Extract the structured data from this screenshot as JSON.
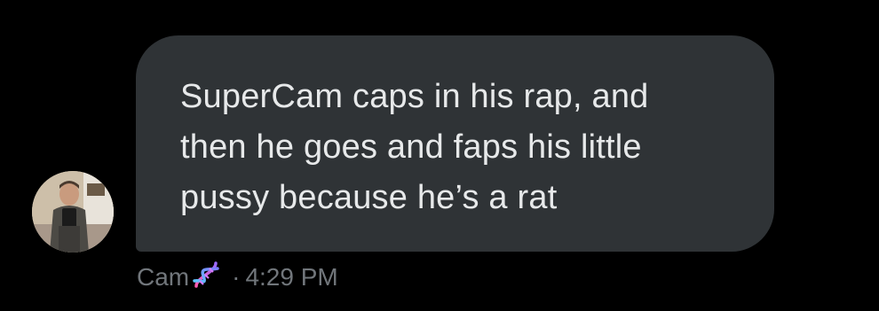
{
  "message": {
    "text": "SuperCam caps in his rap, and\nthen he goes and faps his little\npussy because he’s a rat"
  },
  "sender": {
    "name": "Cam",
    "badge_icon": "dna-icon",
    "separator": "·",
    "time": "4:29 PM"
  },
  "colors": {
    "background": "#000000",
    "bubble": "#2f3336",
    "message_text": "#e7e9ea",
    "meta_text": "#71767b"
  }
}
